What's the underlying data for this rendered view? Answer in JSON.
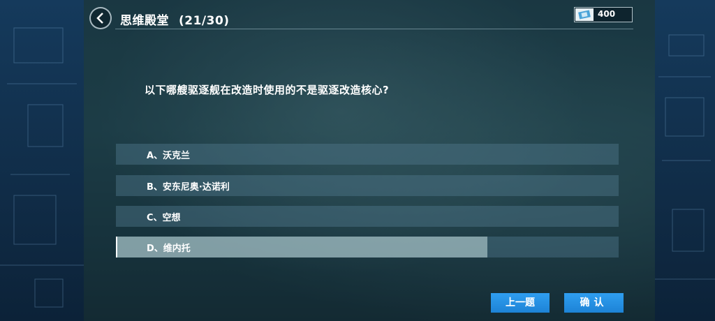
{
  "header": {
    "title": "思维殿堂",
    "progress": "(21/30)"
  },
  "currency": {
    "icon": "ticket-icon",
    "amount": "400"
  },
  "quiz": {
    "question": "以下哪艘驱逐舰在改造时使用的不是驱逐改造核心?",
    "options": [
      {
        "label": "A、沃克兰",
        "selected": false
      },
      {
        "label": "B、安东尼奥·达诺利",
        "selected": false
      },
      {
        "label": "C、空想",
        "selected": false
      },
      {
        "label": "D、维内托",
        "selected": true
      }
    ]
  },
  "buttons": {
    "prev_label": "上一题",
    "confirm_label": "确认"
  },
  "colors": {
    "button_blue": "#2196e8",
    "panel": "#244a4f",
    "sidebar": "#153a5c"
  }
}
